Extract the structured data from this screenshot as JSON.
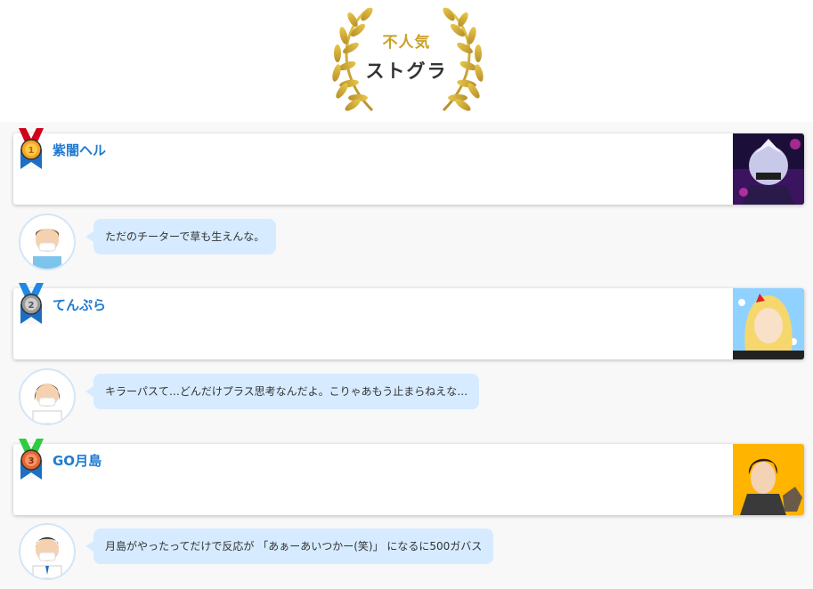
{
  "header": {
    "badge_sub": "不人気",
    "badge_title": "ストグラ"
  },
  "rankings": [
    {
      "rank": 1,
      "name": "紫闇ヘル",
      "medal_color": "#f5a623",
      "ribbon_color": "#d0021b",
      "comment": "ただのチーターで草も生えんな。"
    },
    {
      "rank": 2,
      "name": "てんぷら",
      "medal_color": "#9b9b9b",
      "ribbon_color": "#1e88e5",
      "comment": "キラーパスて…どんだけプラス思考なんだよ。こりゃあもう止まらねえな…"
    },
    {
      "rank": 3,
      "name": "GO月島",
      "medal_color": "#e8642c",
      "ribbon_color": "#2ecc40",
      "comment": "月島がやったってだけで反応が 「あぁーあいつかー(笑)」 になるに500ガバス"
    }
  ],
  "colors": {
    "accent_name": "#1f7bd1",
    "bubble_bg": "#d6ebff",
    "gold": "#c9a227"
  }
}
